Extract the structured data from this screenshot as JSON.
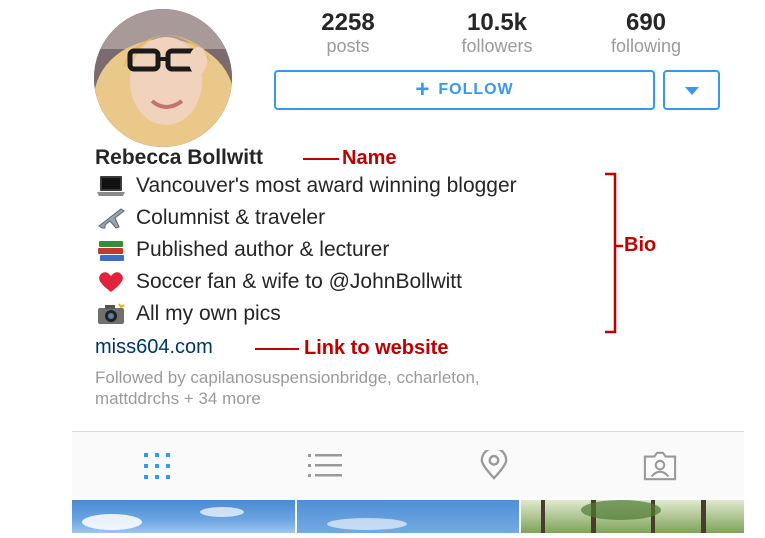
{
  "profile": {
    "avatar_alt": "profile photo",
    "stats": [
      {
        "count": "2258",
        "label": "posts"
      },
      {
        "count": "10.5k",
        "label": "followers"
      },
      {
        "count": "690",
        "label": "following"
      }
    ],
    "follow_label": "FOLLOW",
    "follow_plus": "+",
    "name": "Rebecca Bollwitt",
    "bio": [
      {
        "icon": "laptop-icon",
        "text": "Vancouver's most award winning blogger"
      },
      {
        "icon": "airplane-icon",
        "text": "Columnist & traveler"
      },
      {
        "icon": "books-icon",
        "text": "Published author & lecturer"
      },
      {
        "icon": "heart-icon",
        "text": "Soccer fan & wife to @JohnBollwitt"
      },
      {
        "icon": "camera-icon",
        "text": "All my own pics"
      }
    ],
    "website": "miss604.com",
    "followed_by": [
      "Followed by capilanosuspensionbridge, ccharleton,",
      "mattddrchs + 34 more"
    ]
  },
  "annotations": {
    "name": "Name",
    "bio": "Bio",
    "link": "Link to website"
  },
  "tabs": [
    "grid-icon",
    "list-icon",
    "location-icon",
    "tagged-icon"
  ],
  "colors": {
    "accent": "#3897f0",
    "annotation": "#c00000",
    "link": "#003569",
    "muted": "#9a9a9a"
  }
}
